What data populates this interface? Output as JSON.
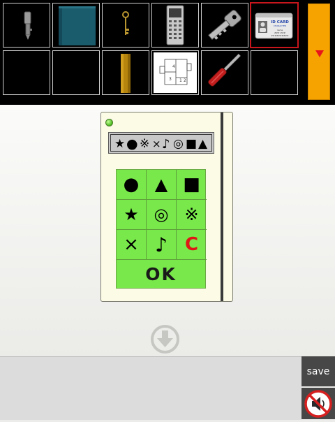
{
  "inventory": {
    "slots": [
      {
        "item": "key-icon",
        "selected": false
      },
      {
        "item": "teal-book-icon",
        "selected": false
      },
      {
        "item": "old-key-icon",
        "selected": false
      },
      {
        "item": "calculator-icon",
        "selected": false
      },
      {
        "item": "silver-key-icon",
        "selected": false
      },
      {
        "item": "id-card-icon",
        "selected": true,
        "card_title": "ID CARD",
        "card_sub": "CHARACTER",
        "card_line1": "name",
        "card_line2": "###  ###",
        "card_line3": "##########"
      },
      {
        "item": "empty",
        "selected": false
      },
      {
        "item": "empty",
        "selected": false
      },
      {
        "item": "battery-icon",
        "selected": false
      },
      {
        "item": "floor-plan-icon",
        "selected": false,
        "plan_num1": "4",
        "plan_num2": "1",
        "plan_num3": "3",
        "plan_num4": "2"
      },
      {
        "item": "screwdriver-icon",
        "selected": false
      },
      {
        "item": "empty",
        "selected": false
      }
    ],
    "scroll_arrow": "down-triangle-icon"
  },
  "device": {
    "display_symbols": [
      "★",
      "●",
      "※",
      "×",
      "♪",
      "◎",
      "■",
      "▲"
    ],
    "keypad": [
      [
        "●",
        "▲",
        "■"
      ],
      [
        "★",
        "◎",
        "※"
      ],
      [
        "×",
        "♪",
        "C"
      ]
    ],
    "ok_label": "OK"
  },
  "controls": {
    "save_label": "save",
    "back_icon": "down-arrow-circle-icon",
    "sound_icon": "sound-muted-icon"
  },
  "colors": {
    "accent": "#f6a300",
    "keypad": "#78e84a",
    "clear": "#e01515",
    "selected_border": "#c8161c"
  }
}
